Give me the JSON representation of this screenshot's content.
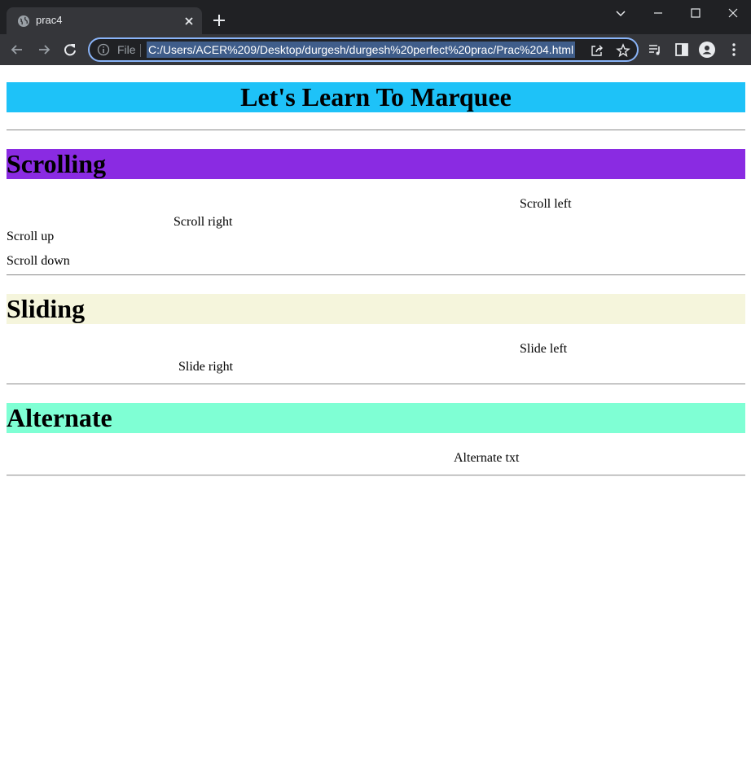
{
  "browser": {
    "tab": {
      "title": "prac4"
    },
    "omnibox": {
      "scheme_label": "File",
      "url": "C:/Users/ACER%209/Desktop/durgesh/durgesh%20perfect%20prac/Prac%204.html"
    }
  },
  "page": {
    "main_heading": "Let's Learn To Marquee",
    "sections": [
      {
        "heading": "Scrolling",
        "color": "#8a2be2",
        "items": [
          "Scroll left",
          "Scroll right",
          "Scroll up",
          "Scroll down"
        ]
      },
      {
        "heading": "Sliding",
        "color": "#f5f5dc",
        "items": [
          "Slide left",
          "Slide right"
        ]
      },
      {
        "heading": "Alternate",
        "color": "#7fffd4",
        "items": [
          "Alternate txt"
        ]
      }
    ],
    "main_heading_color": "#1ec2f8"
  }
}
